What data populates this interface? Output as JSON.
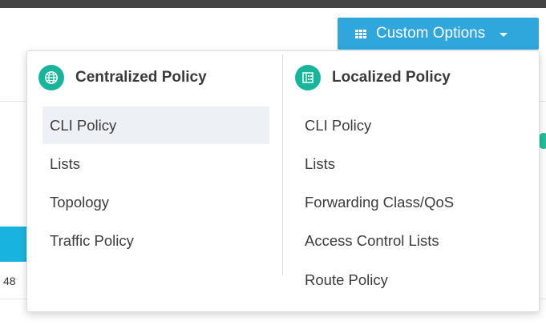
{
  "toolbar": {
    "custom_options_label": "Custom Options",
    "grid_icon": "grid-icon",
    "caret_icon": "caret-down-icon",
    "button_color": "#2fa7dd"
  },
  "background": {
    "visible_number": "48"
  },
  "dropdown": {
    "centralized": {
      "title": "Centralized Policy",
      "icon": "globe-icon",
      "items": [
        {
          "label": "CLI Policy",
          "highlighted": true
        },
        {
          "label": "Lists"
        },
        {
          "label": "Topology"
        },
        {
          "label": "Traffic Policy"
        }
      ]
    },
    "localized": {
      "title": "Localized Policy",
      "icon": "building-icon",
      "items": [
        {
          "label": "CLI Policy"
        },
        {
          "label": "Lists"
        },
        {
          "label": "Forwarding Class/QoS"
        },
        {
          "label": "Access Control Lists"
        },
        {
          "label": "Route Policy"
        }
      ]
    },
    "icon_color": "#17b69a",
    "highlight_color": "#edf1f6"
  }
}
